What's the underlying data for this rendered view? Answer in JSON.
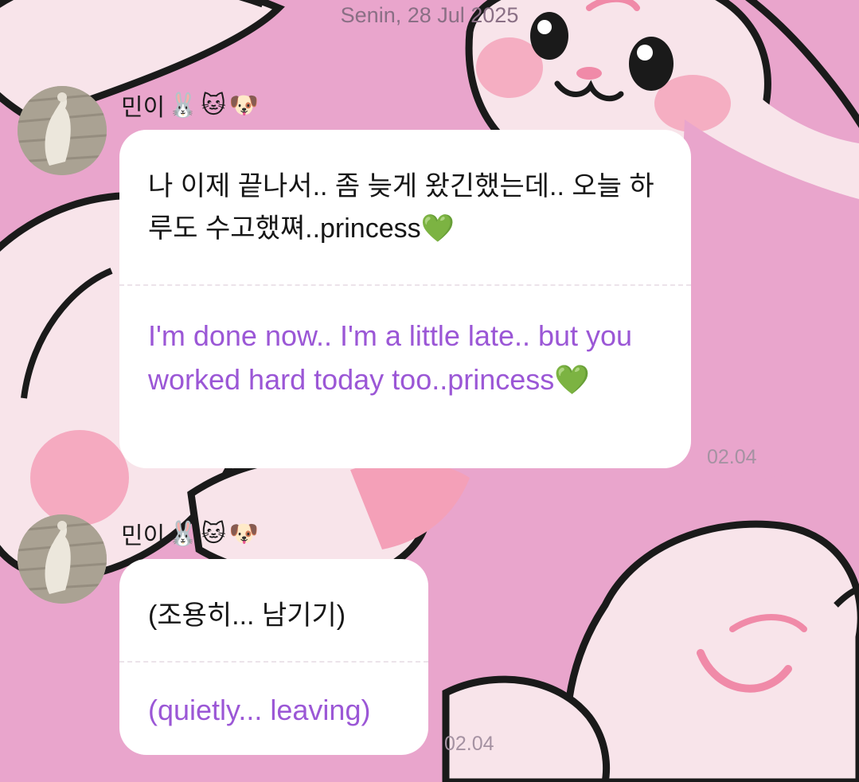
{
  "chat": {
    "date_label": "Senin, 28 Jul 2025"
  },
  "messages": [
    {
      "sender": "민이",
      "sender_emojis": [
        "🐰",
        "🐱",
        "🐶"
      ],
      "text": "나 이제 끝나서.. 좀 늦게 왔긴했는데.. 오늘 하루도 수고했쪄..princess💚",
      "translation": "I'm done now.. I'm a little late.. but you worked hard today too..princess💚",
      "time": "02.04"
    },
    {
      "sender": "민이",
      "sender_emojis": [
        "🐰",
        "🐱",
        "🐶"
      ],
      "text": "(조용히... 남기기)",
      "translation": "(quietly... leaving)",
      "time": "02.04"
    }
  ],
  "colors": {
    "wallpaper_pink": "#e9a5cc",
    "character_fill": "#f8e4ea",
    "cheek_pink": "#f4a0b8",
    "translation_purple": "#9b57d6",
    "heart_green": "#2ebf43"
  }
}
